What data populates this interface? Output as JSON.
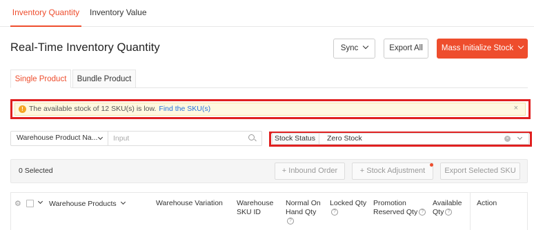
{
  "top_tabs": [
    {
      "label": "Inventory Quantity",
      "active": true
    },
    {
      "label": "Inventory Value",
      "active": false
    }
  ],
  "page_title": "Real-Time Inventory Quantity",
  "header_buttons": {
    "sync": "Sync",
    "export_all": "Export All",
    "mass_initialize": "Mass Initialize Stock"
  },
  "sub_tabs": [
    {
      "label": "Single Product",
      "active": true
    },
    {
      "label": "Bundle Product",
      "active": false
    }
  ],
  "alert": {
    "icon": "info-icon",
    "text": "The available stock of 12 SKU(s) is low.",
    "link": "Find the SKU(s)",
    "close": "×"
  },
  "filter": {
    "select_value": "Warehouse Product Na...",
    "input_placeholder": "Input"
  },
  "stock_status": {
    "label": "Stock Status",
    "value": "Zero Stock"
  },
  "action_bar": {
    "selected": "0 Selected",
    "inbound_order": "+ Inbound Order",
    "stock_adjustment": "+ Stock Adjustment",
    "export_selected": "Export Selected SKU"
  },
  "table": {
    "col_products": "Warehouse Products",
    "col_variation": "Warehouse Variation",
    "col_sku_id_1": "Warehouse",
    "col_sku_id_2": "SKU ID",
    "col_on_hand_1": "Normal On",
    "col_on_hand_2": "Hand Qty",
    "col_locked": "Locked Qty",
    "col_promo_1": "Promotion",
    "col_promo_2": "Reserved Qty",
    "col_available_1": "Available",
    "col_available_2": "Qty",
    "col_action": "Action"
  },
  "colors": {
    "accent": "#ee4d2d",
    "highlight_border": "#e02020",
    "alert_bg": "#fff8e0",
    "link": "#2673dd"
  }
}
